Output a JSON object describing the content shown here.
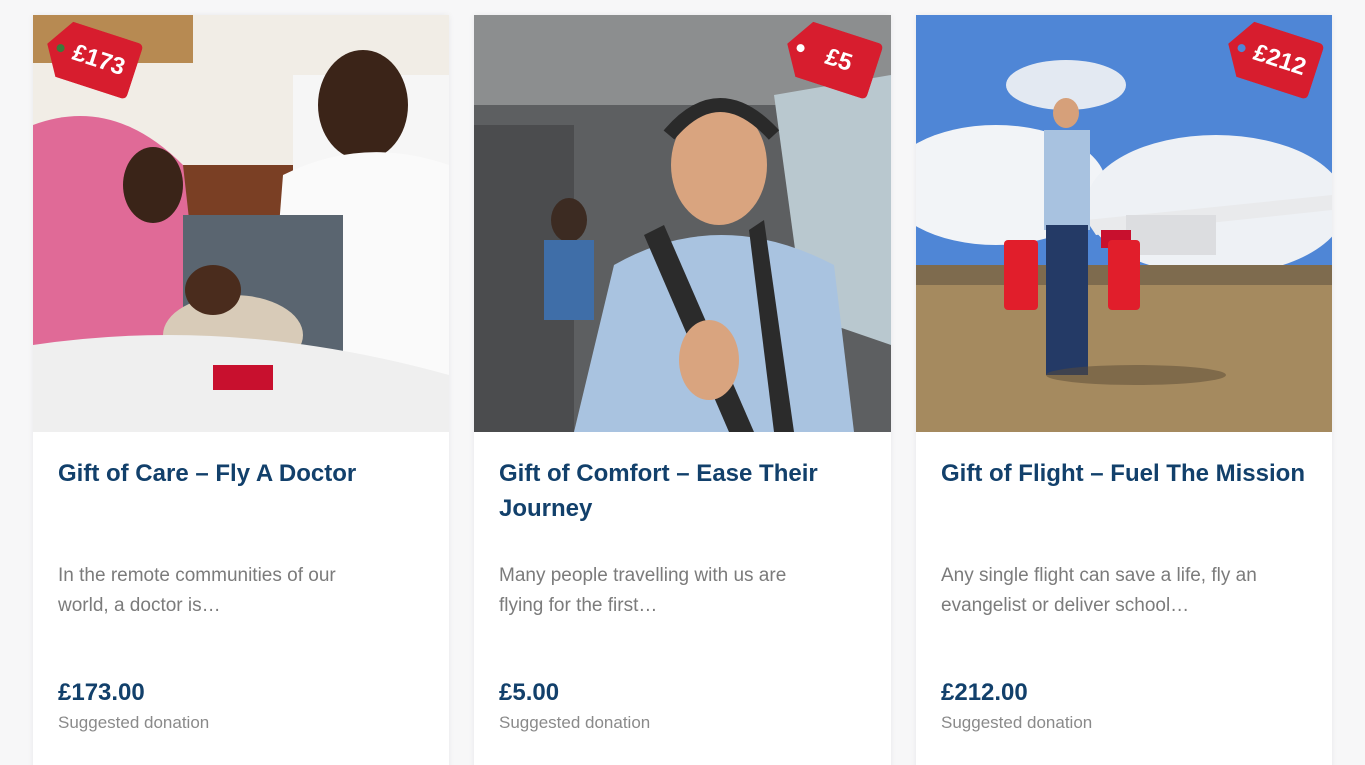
{
  "colors": {
    "title_blue": "#12406b",
    "tag_red": "#d71d2e",
    "text_grey": "#7b7b7b"
  },
  "cards": [
    {
      "tag": "£173",
      "title": "Gift of Care – Fly A Doctor",
      "description": "In the remote communities of our world, a doctor is…",
      "price": "£173.00",
      "price_note": "Suggested donation"
    },
    {
      "tag": "£5",
      "title": "Gift of Comfort – Ease Their Journey",
      "description": "Many people travelling with us are flying for the first…",
      "price": "£5.00",
      "price_note": "Suggested donation"
    },
    {
      "tag": "£212",
      "title": "Gift of Flight – Fuel The Mission",
      "description": "Any single flight can save a life, fly an evangelist or deliver school…",
      "price": "£212.00",
      "price_note": "Suggested donation"
    }
  ]
}
